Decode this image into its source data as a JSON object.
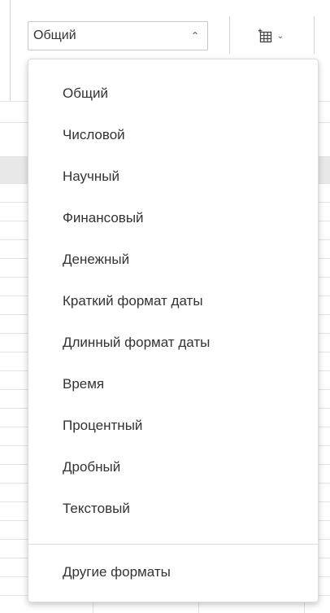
{
  "toolbar": {
    "format_select": {
      "value": "Общий",
      "chevron_icon": "chevron-up-icon"
    },
    "insert_table": {
      "icon": "table-insert-icon",
      "chevron_icon": "chevron-down-icon"
    }
  },
  "format_menu": {
    "items": [
      {
        "label": "Общий"
      },
      {
        "label": "Числовой"
      },
      {
        "label": "Научный"
      },
      {
        "label": "Финансовый"
      },
      {
        "label": "Денежный"
      },
      {
        "label": "Краткий формат даты"
      },
      {
        "label": "Длинный формат даты"
      },
      {
        "label": "Время"
      },
      {
        "label": "Процентный"
      },
      {
        "label": "Дробный"
      },
      {
        "label": "Текстовый"
      }
    ],
    "other_formats_label": "Другие форматы"
  }
}
